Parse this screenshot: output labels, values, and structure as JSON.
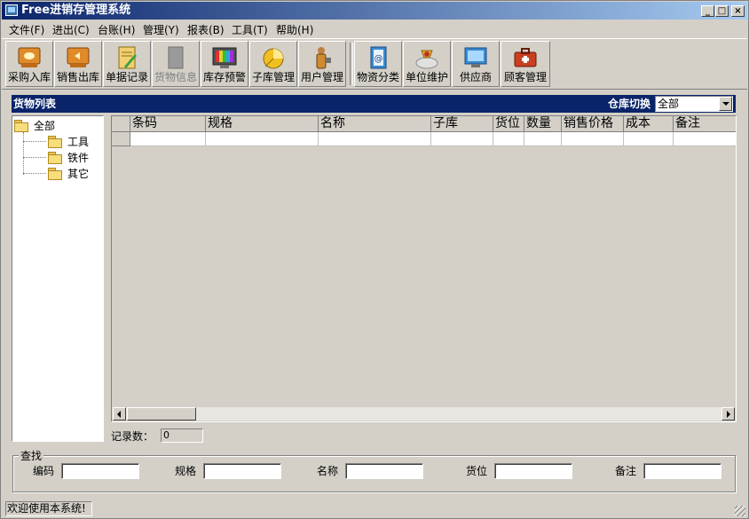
{
  "window": {
    "title": "Free进销存管理系统",
    "minimize_glyph": "_",
    "maximize_glyph": "□",
    "close_glyph": "×"
  },
  "menu": [
    {
      "label": "文件(F)"
    },
    {
      "label": "进出(C)"
    },
    {
      "label": "台账(H)"
    },
    {
      "label": "管理(Y)"
    },
    {
      "label": "报表(B)"
    },
    {
      "label": "工具(T)"
    },
    {
      "label": "帮助(H)"
    }
  ],
  "toolbar": [
    {
      "label": "采购入库",
      "icon": "purchase-in-icon",
      "enabled": true
    },
    {
      "label": "销售出库",
      "icon": "sales-out-icon",
      "enabled": true
    },
    {
      "label": "单据记录",
      "icon": "documents-icon",
      "enabled": true
    },
    {
      "label": "货物信息",
      "icon": "goods-info-icon",
      "enabled": false
    },
    {
      "label": "库存预警",
      "icon": "stock-alert-icon",
      "enabled": true
    },
    {
      "label": "子库管理",
      "icon": "sub-warehouse-icon",
      "enabled": true
    },
    {
      "label": "用户管理",
      "icon": "user-admin-icon",
      "enabled": true
    },
    {
      "label": "物资分类",
      "icon": "category-icon",
      "enabled": true
    },
    {
      "label": "单位维护",
      "icon": "unit-icon",
      "enabled": true
    },
    {
      "label": "供应商",
      "icon": "supplier-icon",
      "enabled": true
    },
    {
      "label": "顾客管理",
      "icon": "customer-icon",
      "enabled": true
    }
  ],
  "panel": {
    "title": "货物列表",
    "warehouse_label": "仓库切换",
    "warehouse_value": "全部"
  },
  "tree": {
    "root": "全部",
    "children": [
      "工具",
      "铁件",
      "其它"
    ]
  },
  "grid": {
    "columns": [
      "条码",
      "规格",
      "名称",
      "子库",
      "货位",
      "数量",
      "销售价格",
      "成本",
      "备注"
    ]
  },
  "records": {
    "label": "记录数：",
    "value": "0"
  },
  "search": {
    "title": "查找",
    "fields": [
      {
        "label": "编码",
        "value": ""
      },
      {
        "label": "规格",
        "value": ""
      },
      {
        "label": "名称",
        "value": ""
      },
      {
        "label": "货位",
        "value": ""
      },
      {
        "label": "备注",
        "value": ""
      }
    ]
  },
  "status": {
    "text": "欢迎使用本系统!"
  },
  "colors": {
    "title_start": "#0a246a",
    "title_end": "#a6caf0",
    "panel_header": "#0a246a",
    "face": "#d4d0c8"
  }
}
